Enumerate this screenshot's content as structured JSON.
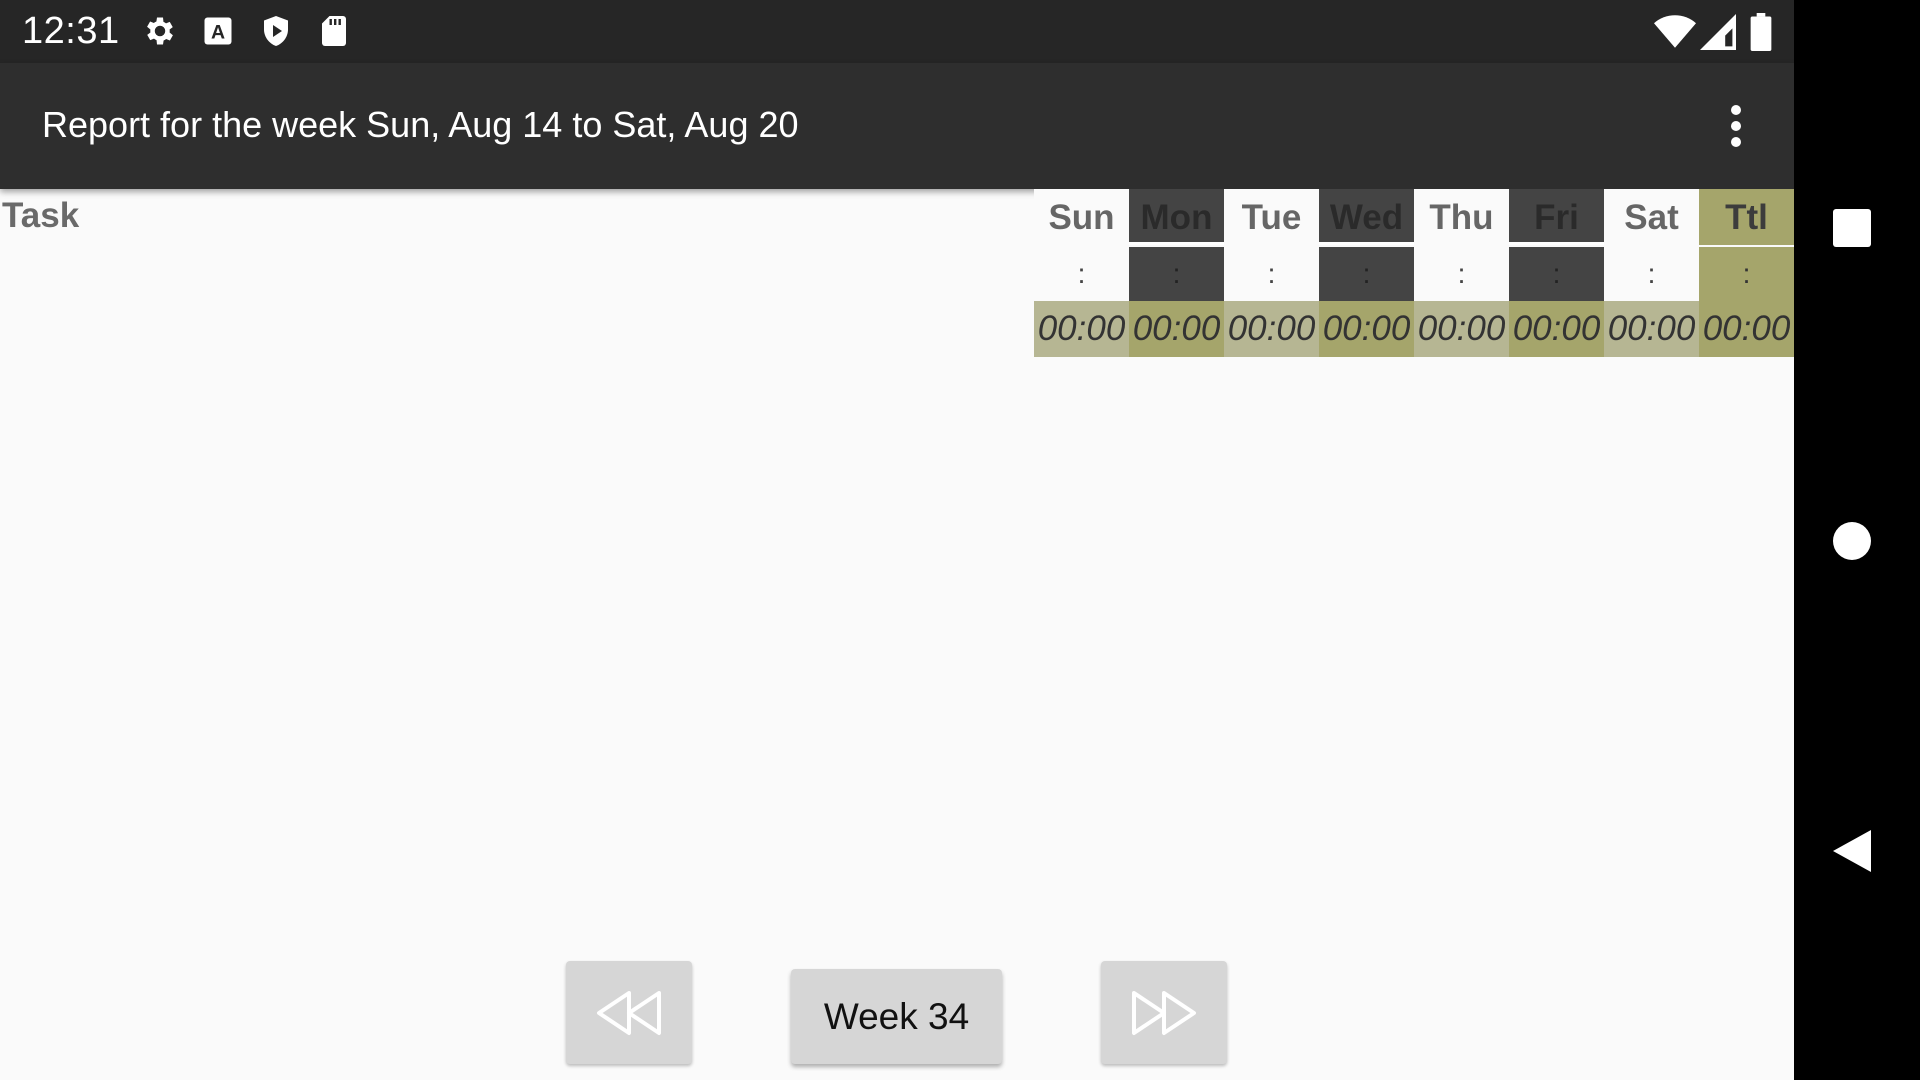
{
  "status_bar": {
    "time": "12:31",
    "left_icons": [
      "gear-icon",
      "a-icon",
      "shield-play-icon",
      "sd-card-icon"
    ],
    "right_icons": [
      "wifi-icon",
      "signal-icon",
      "battery-icon"
    ]
  },
  "app_bar": {
    "title": "Report for the week Sun, Aug 14 to Sat, Aug 20",
    "menu_icon": "overflow-menu-icon"
  },
  "table": {
    "task_header": "Task",
    "columns": [
      {
        "label": "Sun",
        "colon": ":",
        "total": "00:00"
      },
      {
        "label": "Mon",
        "colon": ":",
        "total": "00:00"
      },
      {
        "label": "Tue",
        "colon": ":",
        "total": "00:00"
      },
      {
        "label": "Wed",
        "colon": ":",
        "total": "00:00"
      },
      {
        "label": "Thu",
        "colon": ":",
        "total": "00:00"
      },
      {
        "label": "Fri",
        "colon": ":",
        "total": "00:00"
      },
      {
        "label": "Sat",
        "colon": ":",
        "total": "00:00"
      },
      {
        "label": "Ttl",
        "colon": ":",
        "total": "00:00"
      }
    ]
  },
  "footer": {
    "prev_icon": "rewind-icon",
    "week_label": "Week 34",
    "next_icon": "fast-forward-icon"
  },
  "nav_bar": {
    "icons": [
      "recents-square-icon",
      "home-circle-icon",
      "back-triangle-icon"
    ]
  },
  "colors": {
    "status_bar": "#262626",
    "app_bar": "#2e2e2e",
    "dark_day": "#444444",
    "olive": "#a5a56b",
    "olive_light": "#b6b693"
  }
}
